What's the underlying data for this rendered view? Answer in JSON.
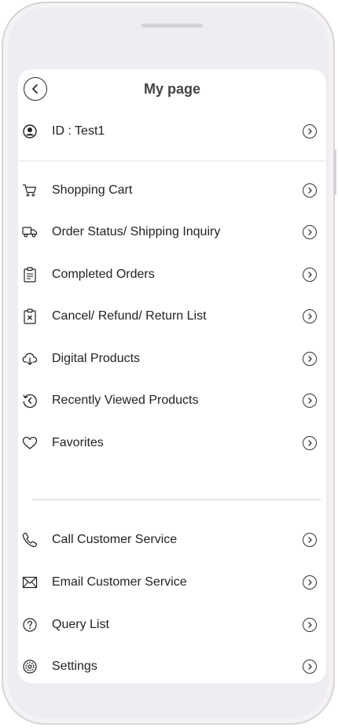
{
  "header": {
    "title": "My page"
  },
  "user": {
    "id_label": "ID : Test1"
  },
  "menu": {
    "shopping": [
      {
        "label": "Shopping Cart",
        "icon": "cart-icon"
      },
      {
        "label": "Order Status/ Shipping Inquiry",
        "icon": "truck-icon"
      },
      {
        "label": "Completed Orders",
        "icon": "clipboard-icon"
      },
      {
        "label": "Cancel/ Refund/ Return List",
        "icon": "clipboard-cancel-icon"
      },
      {
        "label": "Digital Products",
        "icon": "cloud-download-icon"
      },
      {
        "label": "Recently Viewed Products",
        "icon": "history-icon"
      },
      {
        "label": "Favorites",
        "icon": "heart-icon"
      }
    ],
    "support": [
      {
        "label": "Call Customer Service",
        "icon": "phone-icon"
      },
      {
        "label": "Email Customer Service",
        "icon": "mail-icon"
      },
      {
        "label": "Query List",
        "icon": "question-icon"
      },
      {
        "label": "Settings",
        "icon": "settings-icon"
      }
    ]
  }
}
